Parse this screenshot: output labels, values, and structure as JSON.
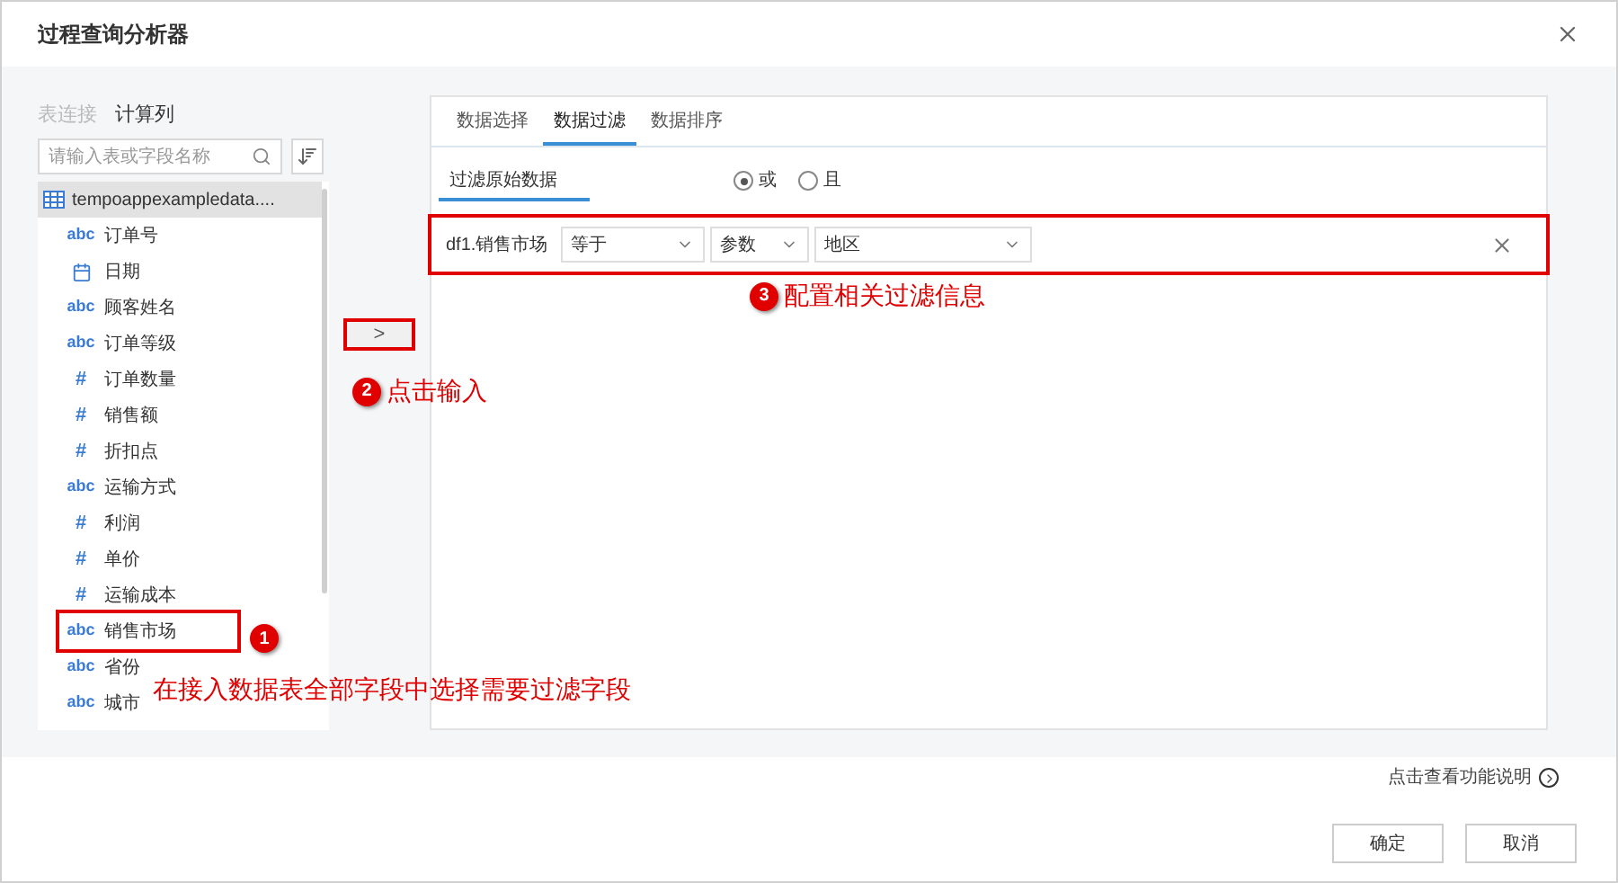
{
  "window": {
    "title": "过程查询分析器"
  },
  "left_tabs": [
    {
      "label": "表连接",
      "selected": false
    },
    {
      "label": "计算列",
      "selected": true
    }
  ],
  "search": {
    "placeholder": "请输入表或字段名称"
  },
  "tree": {
    "label": "tempoappexampledata....",
    "selected": true,
    "children": [
      {
        "label": "订单号",
        "kind": "text",
        "type_label": "abc",
        "highlighted": false
      },
      {
        "label": "日期",
        "kind": "date",
        "highlighted": false
      },
      {
        "label": "顾客姓名",
        "kind": "text",
        "type_label": "abc",
        "highlighted": false
      },
      {
        "label": "订单等级",
        "kind": "text",
        "type_label": "abc",
        "highlighted": false
      },
      {
        "label": "订单数量",
        "kind": "number",
        "type_label": "#",
        "highlighted": false
      },
      {
        "label": "销售额",
        "kind": "number",
        "type_label": "#",
        "highlighted": false
      },
      {
        "label": "折扣点",
        "kind": "number",
        "type_label": "#",
        "highlighted": false
      },
      {
        "label": "运输方式",
        "kind": "text",
        "type_label": "abc",
        "highlighted": false
      },
      {
        "label": "利润",
        "kind": "number",
        "type_label": "#",
        "highlighted": false
      },
      {
        "label": "单价",
        "kind": "number",
        "type_label": "#",
        "highlighted": false
      },
      {
        "label": "运输成本",
        "kind": "number",
        "type_label": "#",
        "highlighted": false
      },
      {
        "label": "销售市场",
        "kind": "text",
        "type_label": "abc",
        "highlighted": true
      },
      {
        "label": "省份",
        "kind": "text",
        "type_label": "abc",
        "highlighted": false
      },
      {
        "label": "城市",
        "kind": "text",
        "type_label": "abc",
        "highlighted": false
      }
    ]
  },
  "move_button": {
    "label": ">",
    "highlighted": true
  },
  "right_tabs": [
    {
      "label": "数据选择",
      "selected": false
    },
    {
      "label": "数据过滤",
      "selected": true
    },
    {
      "label": "数据排序",
      "selected": false
    }
  ],
  "filter_tab": {
    "label": "过滤原始数据"
  },
  "logic": [
    {
      "label": "或",
      "selected": true
    },
    {
      "label": "且",
      "selected": false
    }
  ],
  "filter_row": {
    "field": "df1.销售市场",
    "operator": "等于",
    "source": "参数",
    "value": "地区",
    "highlighted": true
  },
  "annotations": [
    {
      "number": "3",
      "text": "配置相关过滤信息"
    },
    {
      "number": "2",
      "text": "点击输入"
    },
    {
      "number": "1",
      "text": "在接入数据表全部字段中选择需要过滤字段"
    }
  ],
  "help_link": "点击查看功能说明",
  "buttons": [
    "确定",
    "取消"
  ]
}
